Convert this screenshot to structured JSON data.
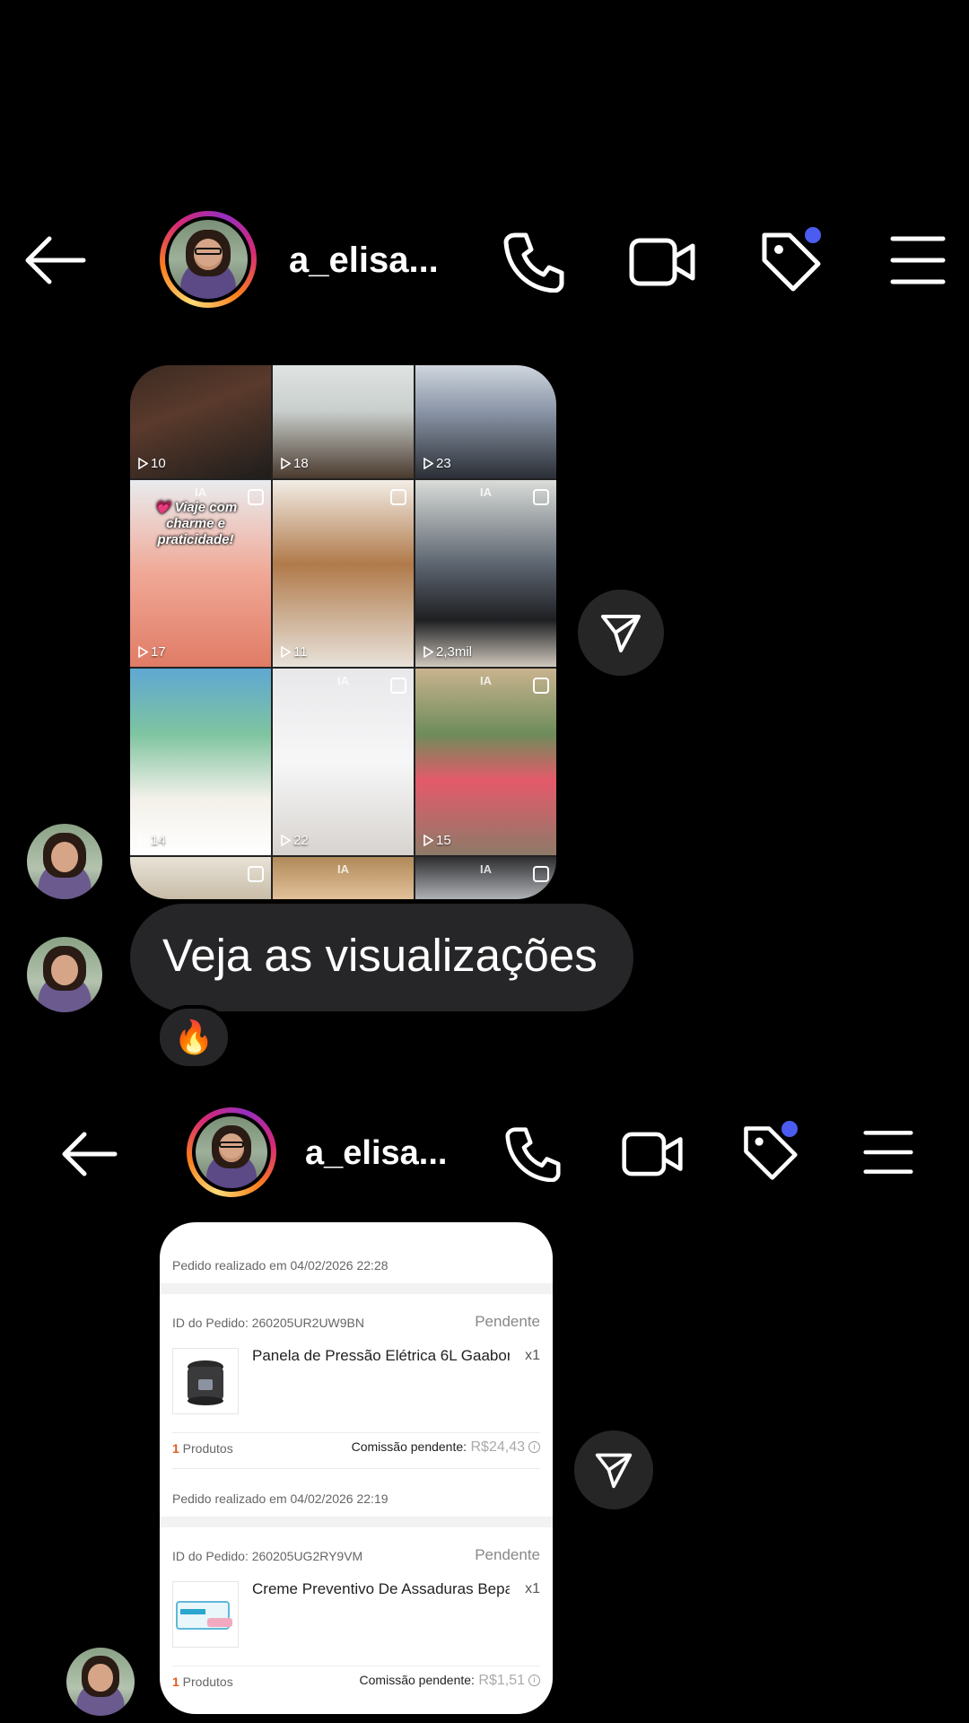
{
  "header_top": {
    "username": "a_elisa..."
  },
  "grid": {
    "tiles": [
      {
        "views": "10",
        "bg": "linear-gradient(160deg,#3b2a22 0%,#5a3a2c 40%,#1f1d1b 100%)"
      },
      {
        "views": "18",
        "bg": "linear-gradient(180deg,#dfe4e2 0%,#c9cfcc 40%,#4a3a2e 100%)"
      },
      {
        "views": "23",
        "bg": "linear-gradient(180deg,#cfd6de 0%,#8b96a8 40%,#2b2f36 100%)"
      },
      {
        "views": "17",
        "bg": "linear-gradient(180deg,#e9ecef 0%,#f0a896 50%,#e07c66 100%)",
        "overlay": "💗 Viaje com charme e praticidade!",
        "ia": "IA",
        "bag": true
      },
      {
        "views": "11",
        "bg": "linear-gradient(180deg,#f2ede6 0%,#b07a4a 45%,#e8e2da 100%)",
        "bag": true
      },
      {
        "views": "2,3mil",
        "bg": "linear-gradient(180deg,#d9dcd8 0%,#5d6570 45%,#1e1f22 75%,#cfc8bd 100%)",
        "ia": "IA",
        "bag": true
      },
      {
        "views": "14",
        "bg": "linear-gradient(180deg,#5fa8d3 0%,#7ec4a0 35%,#f4f1ea 70%,#ffffff 100%)"
      },
      {
        "views": "22",
        "bg": "linear-gradient(180deg,#e8e8ea 0%,#f7f7f8 50%,#d7d3cf 100%)",
        "ia": "IA",
        "bag": true
      },
      {
        "views": "15",
        "bg": "linear-gradient(180deg,#c9b38f 0%,#6e8c5a 35%,#e45a6a 60%,#8d7a68 100%)",
        "ia": "IA",
        "bag": true
      },
      {
        "views": "",
        "bg": "linear-gradient(180deg,#e8e2d6 0%,#c4b8a2 100%)",
        "bag": true
      },
      {
        "views": "",
        "bg": "linear-gradient(180deg,#b08a5a 0%,#e8c7a0 100%)",
        "ia": "IA"
      },
      {
        "views": "",
        "bg": "linear-gradient(180deg,#2e2e30 0%,#bfc2c6 100%)",
        "ia": "IA",
        "bag": true
      }
    ]
  },
  "message": {
    "text": "Veja as visualizações",
    "reaction": "🔥"
  },
  "header_bottom": {
    "username": "a_elisa..."
  },
  "orders": [
    {
      "placed": "Pedido realizado em 04/02/2026 22:28",
      "id": "ID do Pedido: 260205UR2UW9BN",
      "status": "Pendente",
      "product": "Panela de Pressão Elétrica 6L Gaabor ...",
      "qty": "x1",
      "count_num": "1",
      "count_label": " Produtos",
      "commission_label": "Comissão pendente:",
      "commission_value": "R$24,43"
    },
    {
      "placed": "Pedido realizado em 04/02/2026 22:19",
      "id": "ID do Pedido: 260205UG2RY9VM",
      "status": "Pendente",
      "product": "Creme Preventivo De Assaduras Bepa...",
      "qty": "x1",
      "count_num": "1",
      "count_label": " Produtos",
      "commission_label": "Comissão pendente:",
      "commission_value": "R$1,51"
    }
  ],
  "icons": {
    "back": "arrow-left-icon",
    "call": "phone-icon",
    "video": "video-camera-icon",
    "tag": "tag-icon",
    "menu": "menu-icon",
    "share": "send-icon",
    "info": "i"
  },
  "colors": {
    "badge": "#4b5cf0",
    "bubble": "#262628",
    "accent_orange": "#e05a1c"
  }
}
